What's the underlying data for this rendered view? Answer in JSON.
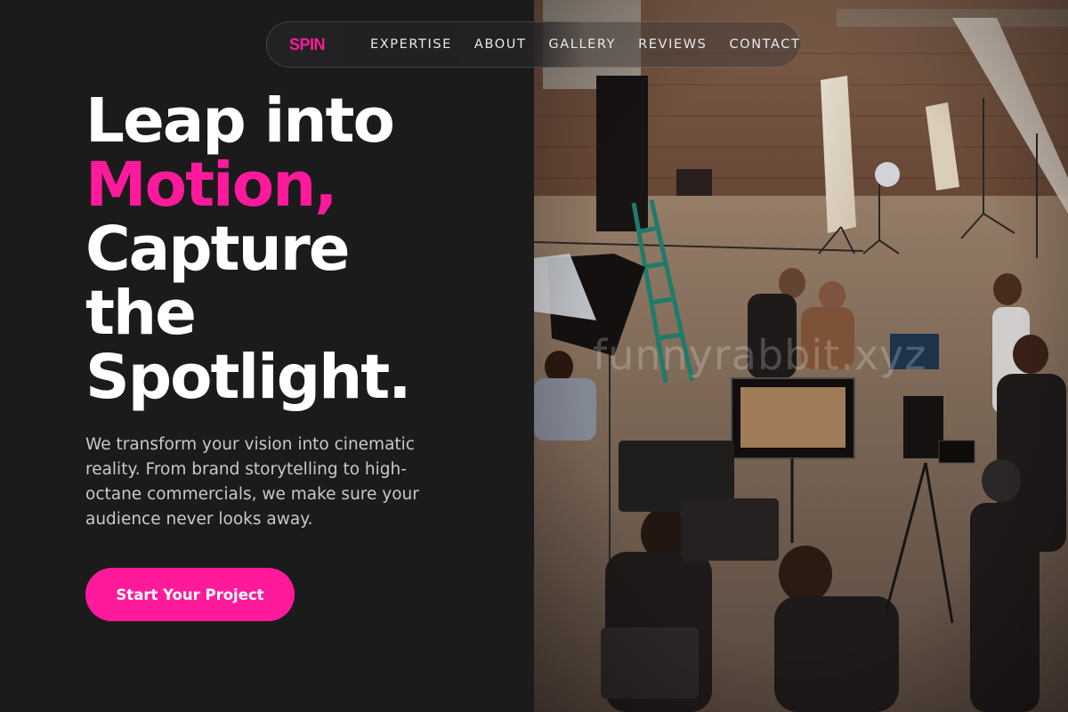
{
  "nav": {
    "logo": "SPIN",
    "links": [
      "EXPERTISE",
      "ABOUT",
      "GALLERY",
      "REVIEWS",
      "CONTACT"
    ]
  },
  "hero": {
    "headline": {
      "line1": "Leap into",
      "line2": "Motion,",
      "line3": "Capture",
      "line4": "the",
      "line5": "Spotlight."
    },
    "description": "We transform your vision into cinematic reality. From brand storytelling to high-octane commercials, we make sure your audience never looks away.",
    "cta_label": "Start Your Project"
  },
  "watermark": "funnyrabbit.xyz",
  "colors": {
    "accent": "#ff1a9c",
    "background": "#1b1b1c",
    "text": "#ffffff",
    "muted_text": "#c9c9cc"
  },
  "icons": {
    "photo": "film-set-photo"
  }
}
